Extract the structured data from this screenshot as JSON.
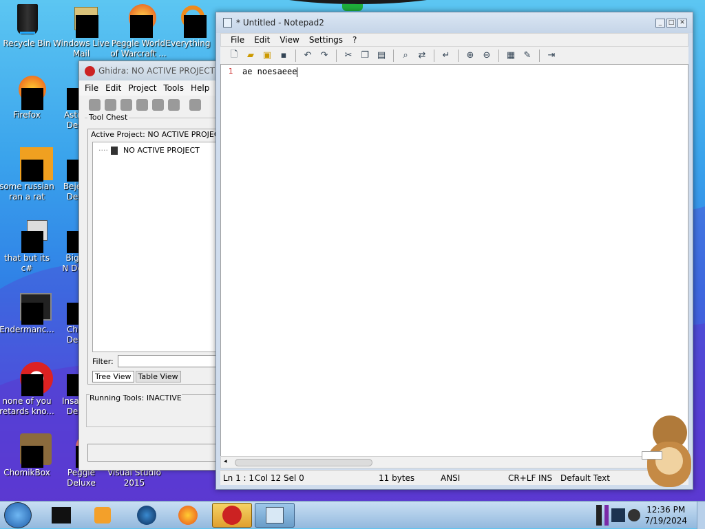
{
  "desktop": {
    "icons": [
      {
        "label": "Recycle Bin"
      },
      {
        "label": "Windows Live Mail"
      },
      {
        "label": "Peggle World of Warcraft ..."
      },
      {
        "label": "Everything"
      },
      {
        "label": "Firefox"
      },
      {
        "label": "Astr De"
      },
      {
        "label": "some russian ran a rat"
      },
      {
        "label": "Beje De"
      },
      {
        "label": "that but its c#"
      },
      {
        "label": "Big N De"
      },
      {
        "label": "Endermanc..."
      },
      {
        "label": "Ch De"
      },
      {
        "label": "none of you retards kno..."
      },
      {
        "label": "Insan De"
      },
      {
        "label": "ChomikBox"
      },
      {
        "label": "Peggle Deluxe"
      },
      {
        "label": "Visual Studio 2015"
      }
    ]
  },
  "ghidra": {
    "title": "Ghidra: NO ACTIVE PROJECT",
    "menu": [
      "File",
      "Edit",
      "Project",
      "Tools",
      "Help"
    ],
    "tool_chest_label": "Tool Chest",
    "active_project_label": "Active Project: NO ACTIVE PROJECT",
    "tree_item": "NO ACTIVE PROJECT",
    "filter_label": "Filter:",
    "tabs": [
      "Tree View",
      "Table View"
    ],
    "running_tools_label": "Running Tools: INACTIVE"
  },
  "notepad": {
    "title": "* Untitled - Notepad2",
    "menu": [
      "File",
      "Edit",
      "View",
      "Settings",
      "?"
    ],
    "line_number": "1",
    "content": "ae noesaeee",
    "status": {
      "position": "Ln 1 : 1",
      "column": "Col 12",
      "selection": "Sel 0",
      "size": "11 bytes",
      "encoding": "ANSI",
      "line_endings": "CR+LF",
      "mode": "INS",
      "scheme": "Default Text"
    }
  },
  "taskbar": {
    "time": "12:36 PM",
    "date": "7/19/2024"
  }
}
